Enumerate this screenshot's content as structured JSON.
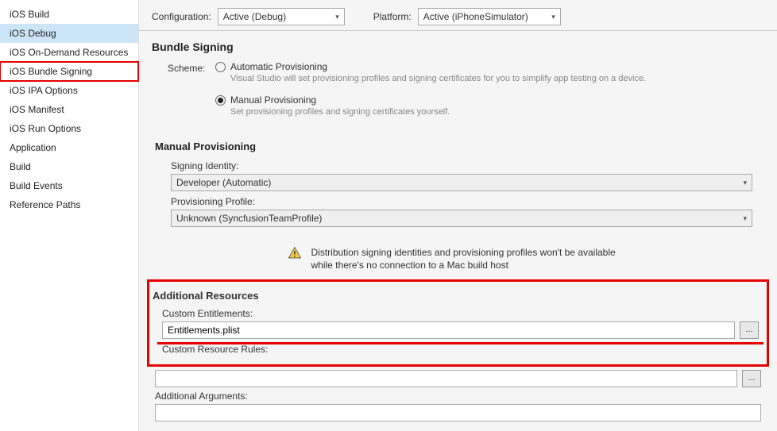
{
  "sidebar": {
    "items": [
      {
        "label": "iOS Build"
      },
      {
        "label": "iOS Debug"
      },
      {
        "label": "iOS On-Demand Resources"
      },
      {
        "label": "iOS Bundle Signing"
      },
      {
        "label": "iOS IPA Options"
      },
      {
        "label": "iOS Manifest"
      },
      {
        "label": "iOS Run Options"
      },
      {
        "label": "Application"
      },
      {
        "label": "Build"
      },
      {
        "label": "Build Events"
      },
      {
        "label": "Reference Paths"
      }
    ]
  },
  "topbar": {
    "config_label": "Configuration:",
    "config_value": "Active (Debug)",
    "platform_label": "Platform:",
    "platform_value": "Active (iPhoneSimulator)"
  },
  "bundle": {
    "title": "Bundle Signing",
    "scheme_label": "Scheme:",
    "auto": {
      "title": "Automatic Provisioning",
      "desc": "Visual Studio will set provisioning profiles and signing certificates for you to simplify app testing on a device."
    },
    "manual": {
      "title": "Manual Provisioning",
      "desc": "Set provisioning profiles and signing certificates yourself."
    }
  },
  "manual_section": {
    "title": "Manual Provisioning",
    "signing_label": "Signing Identity:",
    "signing_value": "Developer (Automatic)",
    "profile_label": "Provisioning Profile:",
    "profile_value": "Unknown (SyncfusionTeamProfile)"
  },
  "warning": {
    "text": "Distribution signing identities and provisioning profiles won't be available while there's no connection to a Mac build host"
  },
  "additional": {
    "title": "Additional Resources",
    "entitlements_label": "Custom Entitlements:",
    "entitlements_value": "Entitlements.plist",
    "rules_label": "Custom Resource Rules:",
    "rules_value": "",
    "args_label": "Additional Arguments:",
    "args_value": "",
    "browse": "..."
  }
}
